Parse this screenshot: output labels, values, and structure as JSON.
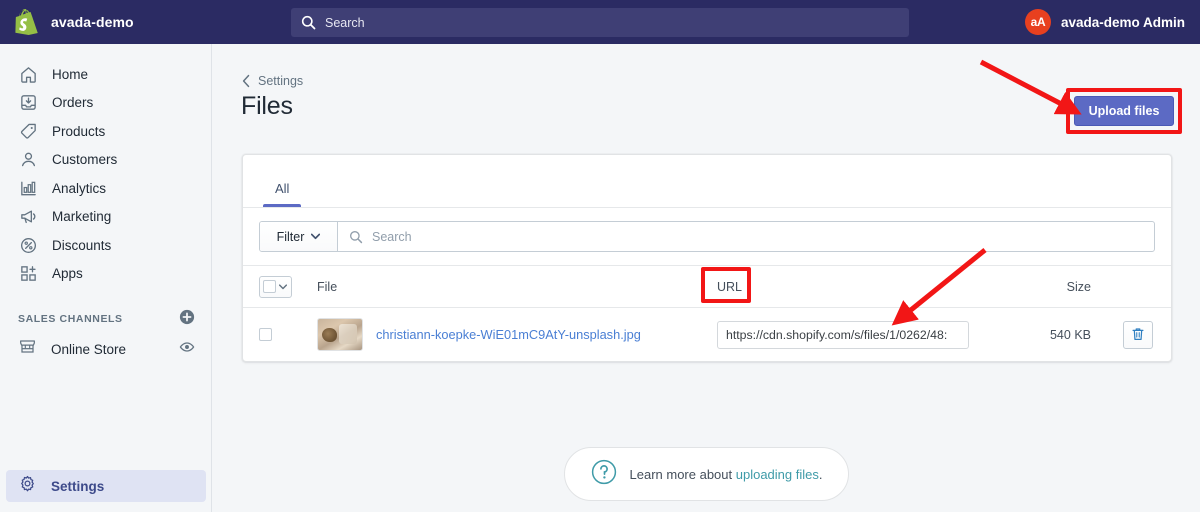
{
  "topbar": {
    "brand_name": "avada-demo",
    "logo_icon": "shopify-bag-icon",
    "search_placeholder": "Search",
    "search_icon": "search-icon",
    "avatar_initials": "aA",
    "user_name": "avada-demo Admin",
    "bg_color": "#2b2b63",
    "search_bg_color": "#3f3f75",
    "avatar_color": "#e8401f"
  },
  "sidebar": {
    "items": [
      {
        "label": "Home",
        "icon": "home-icon"
      },
      {
        "label": "Orders",
        "icon": "orders-inbox-icon"
      },
      {
        "label": "Products",
        "icon": "tag-icon"
      },
      {
        "label": "Customers",
        "icon": "person-icon"
      },
      {
        "label": "Analytics",
        "icon": "bar-chart-icon"
      },
      {
        "label": "Marketing",
        "icon": "megaphone-icon"
      },
      {
        "label": "Discounts",
        "icon": "percent-circle-icon"
      },
      {
        "label": "Apps",
        "icon": "apps-grid-plus-icon"
      }
    ],
    "sales_channels": {
      "title": "SALES CHANNELS",
      "add_icon": "plus-circle-icon",
      "channels": [
        {
          "label": "Online Store",
          "icon": "storefront-icon",
          "action_icon": "eye-icon"
        }
      ]
    },
    "settings": {
      "label": "Settings",
      "icon": "gear-icon",
      "active": true,
      "active_bg_color": "#dfe3f3",
      "active_text_color": "#3d4a8a"
    }
  },
  "main": {
    "breadcrumb": {
      "label": "Settings",
      "icon": "chevron-left-icon"
    },
    "page_title": "Files",
    "upload_button": {
      "label": "Upload files",
      "bg_color": "#5c6ac4"
    },
    "card": {
      "tabs": [
        {
          "label": "All",
          "active": true
        }
      ],
      "filter": {
        "button_label": "Filter",
        "button_icon": "chevron-down-icon",
        "search_placeholder": "Search",
        "search_icon": "search-icon"
      },
      "table": {
        "headers": {
          "select_all_icon": "checkbox-dropdown-icon",
          "file": "File",
          "url": "URL",
          "size": "Size"
        },
        "rows": [
          {
            "checkbox_checked": false,
            "thumbnail_icon": "image-thumbnail",
            "file_name": "christiann-koepke-WiE01mC9AtY-unsplash.jpg",
            "url_value": "https://cdn.shopify.com/s/files/1/0262/48:",
            "size": "540 KB",
            "delete_icon": "trash-icon"
          }
        ]
      }
    },
    "help": {
      "icon": "question-circle-icon",
      "text_prefix": "Learn more about ",
      "link_text": "uploading files",
      "text_suffix": ".",
      "link_color": "#3f9ba8"
    }
  },
  "annotations": {
    "color": "#f21616",
    "boxes": [
      {
        "target": "upload-files-button"
      },
      {
        "target": "url-column-header"
      }
    ],
    "arrows": [
      {
        "target": "upload-files-button",
        "direction": "down-right"
      },
      {
        "target": "url-field",
        "direction": "down-left"
      }
    ]
  }
}
